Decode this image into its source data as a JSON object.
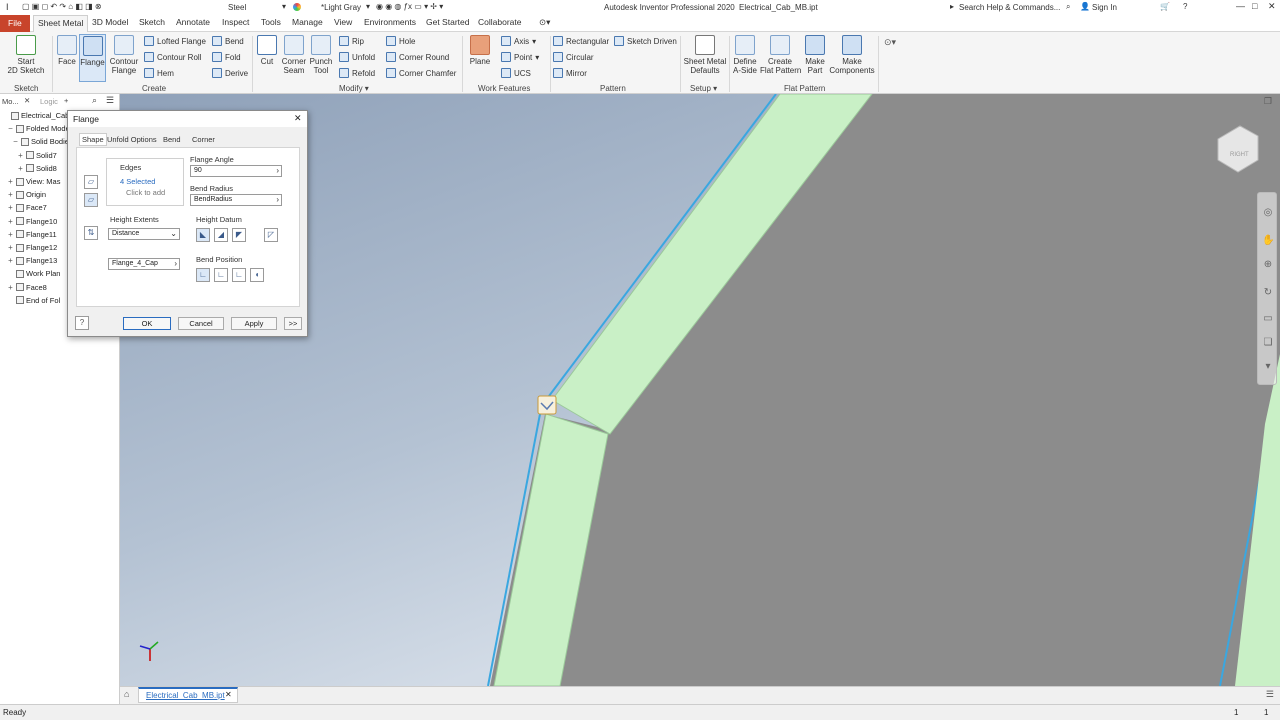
{
  "titlebar": {
    "material": "Steel",
    "appearance": "*Light Gray",
    "app_title": "Autodesk Inventor Professional 2020",
    "file_title": "Electrical_Cab_MB.ipt",
    "search_placeholder": "Search Help & Commands...",
    "sign_in": "Sign In"
  },
  "tabs": [
    "File",
    "Sheet Metal",
    "3D Model",
    "Sketch",
    "Annotate",
    "Inspect",
    "Tools",
    "Manage",
    "View",
    "Environments",
    "Get Started",
    "Collaborate"
  ],
  "ribbon": {
    "sketch": {
      "start_sketch": "Start\n2D Sketch",
      "group": "Sketch"
    },
    "create": {
      "face": "Face",
      "flange": "Flange",
      "contour_flange": "Contour\nFlange",
      "lofted_flange": "Lofted Flange",
      "contour_roll": "Contour Roll",
      "hem": "Hem",
      "bend": "Bend",
      "fold": "Fold",
      "derive": "Derive",
      "group": "Create"
    },
    "modify": {
      "cut": "Cut",
      "corner_seam": "Corner\nSeam",
      "punch_tool": "Punch\nTool",
      "rip": "Rip",
      "unfold": "Unfold",
      "refold": "Refold",
      "hole": "Hole",
      "corner_round": "Corner Round",
      "corner_chamfer": "Corner Chamfer",
      "group": "Modify"
    },
    "work_features": {
      "plane": "Plane",
      "axis": "Axis",
      "point": "Point",
      "ucs": "UCS",
      "group": "Work Features"
    },
    "pattern": {
      "rectangular": "Rectangular",
      "circular": "Circular",
      "mirror": "Mirror",
      "sketch_driven": "Sketch Driven",
      "group": "Pattern"
    },
    "setup": {
      "sheet_metal_defaults": "Sheet Metal\nDefaults",
      "group": "Setup"
    },
    "flat_pattern": {
      "define_a_side": "Define\nA-Side",
      "create_flat_pattern": "Create\nFlat Pattern",
      "make_part": "Make\nPart",
      "make_components": "Make\nComponents",
      "group": "Flat Pattern"
    }
  },
  "browser": {
    "tab_model": "Mo...",
    "tab_logic": "Logic",
    "items": [
      {
        "label": "Electrical_Cab_M",
        "indent": 0,
        "expander": ""
      },
      {
        "label": "Folded Model",
        "indent": 1,
        "expander": "−"
      },
      {
        "label": "Solid Bodies",
        "indent": 2,
        "expander": "−"
      },
      {
        "label": "Solid7",
        "indent": 3,
        "expander": "+"
      },
      {
        "label": "Solid8",
        "indent": 3,
        "expander": "+"
      },
      {
        "label": "View: Mas",
        "indent": 1,
        "expander": "+"
      },
      {
        "label": "Origin",
        "indent": 1,
        "expander": "+"
      },
      {
        "label": "Face7",
        "indent": 1,
        "expander": "+"
      },
      {
        "label": "Flange10",
        "indent": 1,
        "expander": "+"
      },
      {
        "label": "Flange11",
        "indent": 1,
        "expander": "+"
      },
      {
        "label": "Flange12",
        "indent": 1,
        "expander": "+"
      },
      {
        "label": "Flange13",
        "indent": 1,
        "expander": "+"
      },
      {
        "label": "Work Plan",
        "indent": 1,
        "expander": ""
      },
      {
        "label": "Face8",
        "indent": 1,
        "expander": "+"
      },
      {
        "label": "End of Fol",
        "indent": 1,
        "expander": ""
      }
    ]
  },
  "dialog": {
    "title": "Flange",
    "tabs": [
      "Shape",
      "Unfold Options",
      "Bend",
      "Corner"
    ],
    "edges_label": "Edges",
    "edges_selected": "4 Selected",
    "edges_hint": "Click to add",
    "flange_angle_label": "Flange Angle",
    "flange_angle_value": "90",
    "bend_radius_label": "Bend Radius",
    "bend_radius_value": "BendRadius",
    "height_extents_label": "Height Extents",
    "height_extents_value": "Distance",
    "height_value": "Flange_4_Cap",
    "height_datum_label": "Height Datum",
    "bend_position_label": "Bend Position",
    "ok": "OK",
    "cancel": "Cancel",
    "apply": "Apply",
    "more": ">>"
  },
  "viewcube": {
    "face_label": "RIGHT"
  },
  "document_tab": {
    "filename": "Electrical_Cab_MB.ipt"
  },
  "status": {
    "text": "Ready",
    "num1": "1",
    "num2": "1"
  },
  "colors": {
    "file_tab": "#c8442b",
    "flange_green": "#c9f0c6",
    "body_gray": "#8c8c8c",
    "edge_blue": "#3aa7e0"
  }
}
